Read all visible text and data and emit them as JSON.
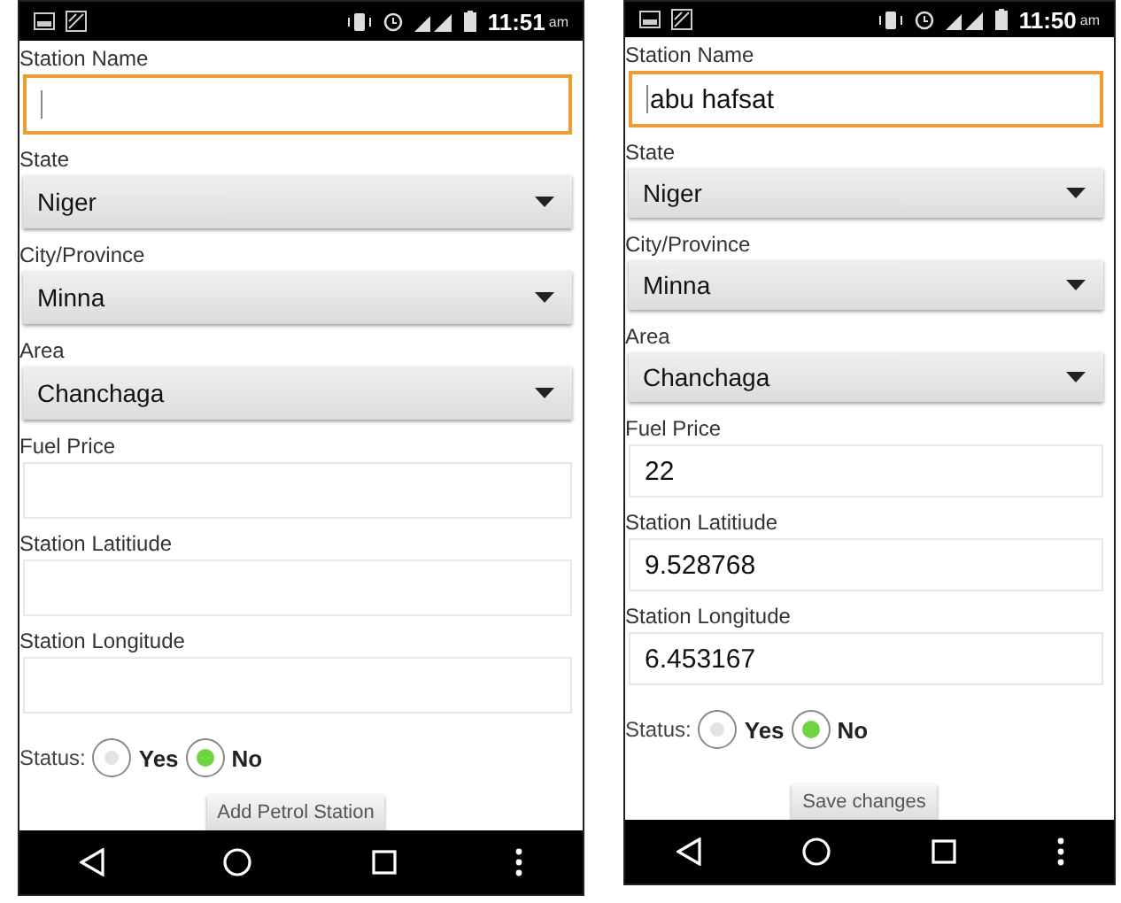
{
  "phones": [
    {
      "status_bar": {
        "time": "11:51",
        "meridiem": "am"
      },
      "fields": [
        {
          "kind": "text",
          "label": "Station Name",
          "focused": true
        },
        {
          "kind": "select",
          "label": "State",
          "value": "Niger"
        },
        {
          "kind": "select",
          "label": "City/Province",
          "value": "Minna"
        },
        {
          "kind": "select",
          "label": "Area",
          "value": "Chanchaga"
        },
        {
          "kind": "text",
          "label": "Fuel Price",
          "focused": false
        },
        {
          "kind": "text",
          "label": "Station Latitiude",
          "focused": false
        },
        {
          "kind": "text",
          "label": "Station Longitude",
          "focused": false
        }
      ],
      "status": {
        "label": "Status:",
        "options": [
          {
            "label": "Yes",
            "selected": false
          },
          {
            "label": "No",
            "selected": true
          }
        ]
      },
      "button": "Add Petrol Station"
    },
    {
      "status_bar": {
        "time": "11:50",
        "meridiem": "am"
      },
      "fields": [
        {
          "kind": "text",
          "label": "Station Name",
          "value": "abu hafsat",
          "focused": true
        },
        {
          "kind": "select",
          "label": "State",
          "value": "Niger"
        },
        {
          "kind": "select",
          "label": "City/Province",
          "value": "Minna"
        },
        {
          "kind": "select",
          "label": "Area",
          "value": "Chanchaga"
        },
        {
          "kind": "text",
          "label": "Fuel Price",
          "value": "22",
          "focused": false
        },
        {
          "kind": "text",
          "label": "Station Latitiude",
          "value": "9.528768",
          "focused": false
        },
        {
          "kind": "text",
          "label": "Station Longitude",
          "value": "6.453167",
          "focused": false
        }
      ],
      "status": {
        "label": "Status:",
        "options": [
          {
            "label": "Yes",
            "selected": false
          },
          {
            "label": "No",
            "selected": true
          }
        ]
      },
      "button": "Save changes"
    }
  ]
}
